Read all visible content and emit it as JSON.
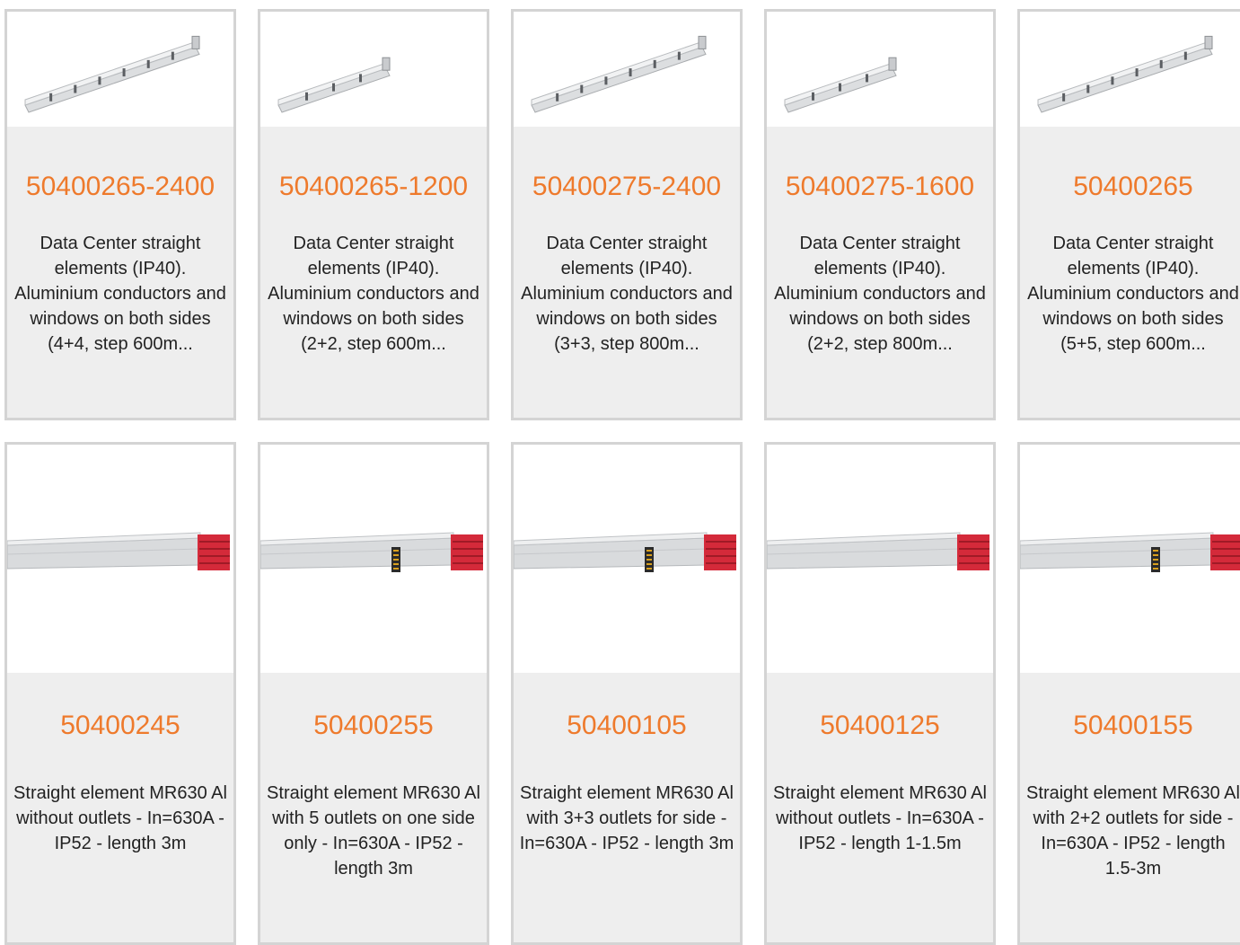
{
  "row1": [
    {
      "code": "50400265-2400",
      "desc": "Data Center straight elements (IP40). Aluminium conductors and windows on both sides (4+4, step 600m...",
      "image": "busbar-long-icon"
    },
    {
      "code": "50400265-1200",
      "desc": "Data Center straight elements (IP40). Aluminium conductors and windows on both sides (2+2, step 600m...",
      "image": "busbar-short-icon"
    },
    {
      "code": "50400275-2400",
      "desc": "Data Center straight elements (IP40). Aluminium conductors and windows on both sides (3+3, step 800m...",
      "image": "busbar-long-icon"
    },
    {
      "code": "50400275-1600",
      "desc": "Data Center straight elements (IP40). Aluminium conductors and windows on both sides (2+2, step 800m...",
      "image": "busbar-short-icon"
    },
    {
      "code": "50400265",
      "desc": "Data Center straight elements (IP40). Aluminium conductors and windows on both sides (5+5, step 600m...",
      "image": "busbar-long-icon"
    }
  ],
  "row2": [
    {
      "code": "50400245",
      "desc": "Straight element MR630 Al without outlets - In=630A - IP52 - length 3m",
      "image": "trunking-no-outlet-icon"
    },
    {
      "code": "50400255",
      "desc": "Straight element MR630 Al with 5 outlets on one side only - In=630A - IP52 - length 3m",
      "image": "trunking-outlet-icon"
    },
    {
      "code": "50400105",
      "desc": "Straight element MR630 Al with 3+3 outlets for side - In=630A - IP52 - length 3m",
      "image": "trunking-outlet-icon"
    },
    {
      "code": "50400125",
      "desc": "Straight element MR630 Al without outlets - In=630A - IP52 - length 1-1.5m",
      "image": "trunking-no-outlet-icon"
    },
    {
      "code": "50400155",
      "desc": "Straight element MR630 Al with 2+2 outlets for side - In=630A - IP52 - length 1.5-3m",
      "image": "trunking-outlet-icon"
    }
  ],
  "colors": {
    "code": "#ee7a2c",
    "card_bg": "#eeeeee",
    "border": "#d4d4d4",
    "connector": "#d42a3a"
  }
}
